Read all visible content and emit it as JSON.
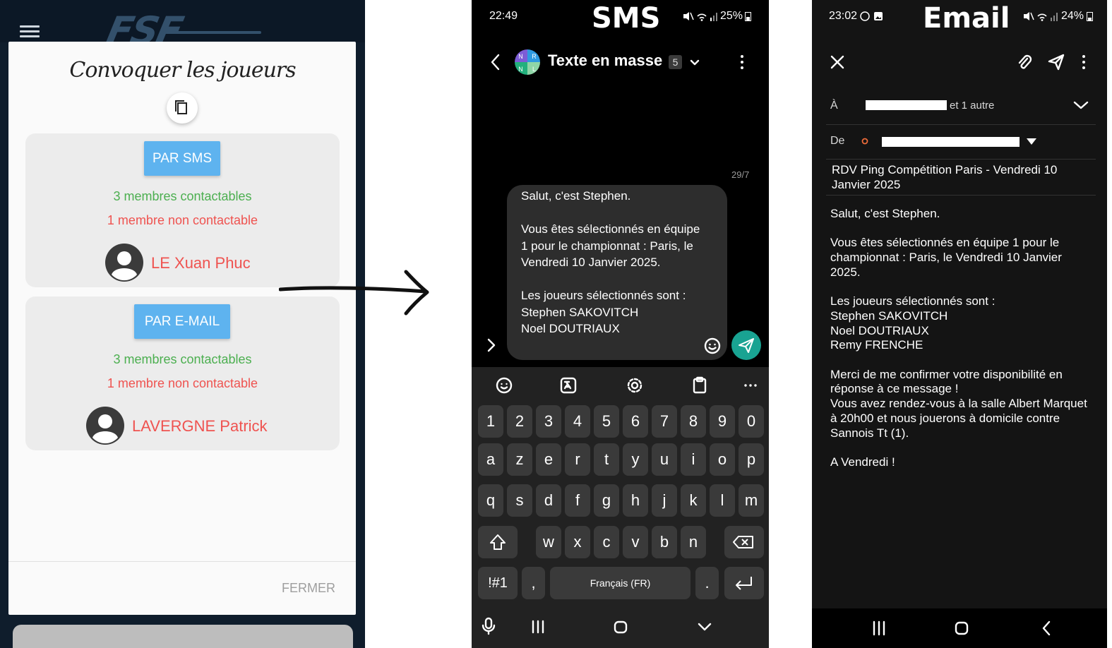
{
  "app_panel": {
    "logo": "FSF",
    "dialog_title": "Convoquer les joueurs",
    "sms_card": {
      "button": "PAR SMS",
      "contactable": "3 membres contactables",
      "non_contactable": "1 membre non contactable",
      "member": "LE Xuan Phuc"
    },
    "email_card": {
      "button": "PAR E-MAIL",
      "contactable": "3 membres contactables",
      "non_contactable": "1 membre non contactable",
      "member": "LAVERGNE Patrick"
    },
    "close_button": "FERMER"
  },
  "sms_panel": {
    "label": "SMS",
    "status": {
      "time": "22:49",
      "battery": "25%"
    },
    "conversation_title": "Texte en masse",
    "participants_count": "5",
    "avatar_letters": [
      "N",
      "R",
      "N",
      "L"
    ],
    "char_counter": "29/7",
    "message": "Salut, c'est Stephen.\n\nVous êtes sélectionnés en équipe 1 pour le championnat : Paris, le Vendredi 10 Janvier 2025.\n\nLes joueurs sélectionnés sont :\nStephen SAKOVITCH\nNoel DOUTRIAUX",
    "keyboard": {
      "row_numbers": [
        "1",
        "2",
        "3",
        "4",
        "5",
        "6",
        "7",
        "8",
        "9",
        "0"
      ],
      "row_1": [
        "a",
        "z",
        "e",
        "r",
        "t",
        "y",
        "u",
        "i",
        "o",
        "p"
      ],
      "row_2": [
        "q",
        "s",
        "d",
        "f",
        "g",
        "h",
        "j",
        "k",
        "l",
        "m"
      ],
      "row_3": [
        "w",
        "x",
        "c",
        "v",
        "b",
        "n"
      ],
      "symbols_key": "!#1",
      "comma": ",",
      "space_label": "Français (FR)",
      "period": "."
    }
  },
  "email_panel": {
    "label": "Email",
    "status": {
      "time": "23:02",
      "battery": "24%"
    },
    "to_label": "À",
    "to_extra": "et 1 autre",
    "from_label": "De",
    "subject": "RDV Ping Compétition Paris - Vendredi 10 Janvier 2025",
    "body": "Salut, c'est Stephen.\n\nVous êtes sélectionnés en équipe 1 pour le championnat : Paris, le Vendredi 10 Janvier 2025.\n\nLes joueurs sélectionnés sont :\nStephen SAKOVITCH\nNoel DOUTRIAUX\nRemy FRENCHE\n\nMerci de me confirmer votre disponibilité en réponse à ce message !\nVous avez rendez-vous à la salle Albert Marquet à 20h00 et nous jouerons à domicile contre Sannois Tt (1).\n\nA Vendredi !"
  },
  "colors": {
    "button_blue": "#5eb3ef",
    "contactable_green": "#4caf50",
    "non_contactable_red": "#ef5350",
    "send_teal": "#19a392"
  }
}
